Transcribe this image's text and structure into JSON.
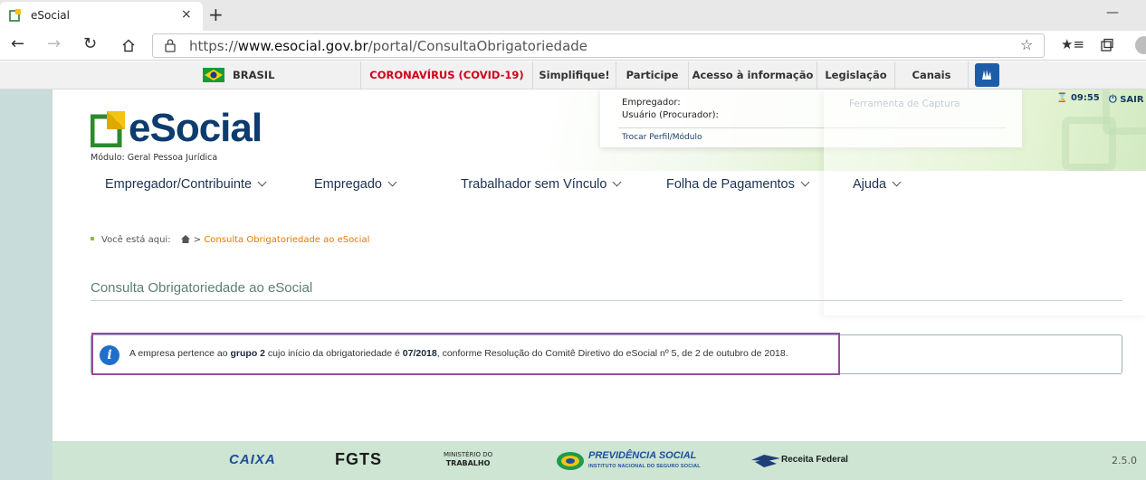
{
  "browser": {
    "tab_title": "eSocial",
    "tab_close": "×",
    "new_tab": "+",
    "window_minimize": "—",
    "url_prefix": "https://",
    "url_host": "www.esocial.gov.br",
    "url_path": "/portal/ConsultaObrigatoriedade",
    "icons": {
      "back": "back-arrow-icon",
      "forward": "forward-arrow-icon",
      "refresh": "refresh-icon",
      "home": "home-icon",
      "lock": "lock-icon",
      "favorite": "star-icon",
      "favorites_list": "favorites-icon",
      "collections": "collections-icon",
      "profile": "avatar"
    }
  },
  "gov_bar": {
    "brasil": "BRASIL",
    "covid": "CORONAVÍRUS (COVID-19)",
    "simplifique": "Simplifique!",
    "participe": "Participe",
    "acesso": "Acesso à informação",
    "legislacao": "Legislação",
    "canais": "Canais",
    "covid_color": "#d0021b"
  },
  "header": {
    "logo_text": "eSocial",
    "module": "Módulo: Geral Pessoa Jurídica",
    "employer_label": "Empregador:",
    "user_label": "Usuário (Procurador):",
    "switch_profile": "Trocar Perfil/Módulo",
    "timer": "09:55",
    "logout": "SAIR",
    "capture_tool": "Ferramenta de Captura"
  },
  "menu": {
    "items": [
      {
        "label": "Empregador/Contribuinte"
      },
      {
        "label": "Empregado"
      },
      {
        "label": "Trabalhador sem Vínculo"
      },
      {
        "label": "Folha de Pagamentos"
      },
      {
        "label": "Ajuda"
      }
    ]
  },
  "breadcrumb": {
    "prefix": "Você está aqui:",
    "separator": ">",
    "current": "Consulta Obrigatoriedade ao eSocial"
  },
  "page": {
    "title": "Consulta Obrigatoriedade ao eSocial",
    "info": {
      "part1": "A empresa pertence ao ",
      "group": "grupo 2",
      "part2": " cujo início da obrigatoriedade é ",
      "date": "07/2018",
      "part3": ", conforme Resolução do Comitê Diretivo do eSocial nº 5, de 2 de outubro de 2018."
    },
    "highlight_color": "#9c4a9b"
  },
  "footer": {
    "caixa": "CAIXA",
    "fgts": "FGTS",
    "mt_line1": "MINISTÉRIO DO",
    "mt_line2": "TRABALHO",
    "previdencia": "PREVIDÊNCIA SOCIAL",
    "previdencia_sub": "INSTITUTO NACIONAL DO SEGURO SOCIAL",
    "receita": "Receita Federal",
    "version": "2.5.0"
  }
}
